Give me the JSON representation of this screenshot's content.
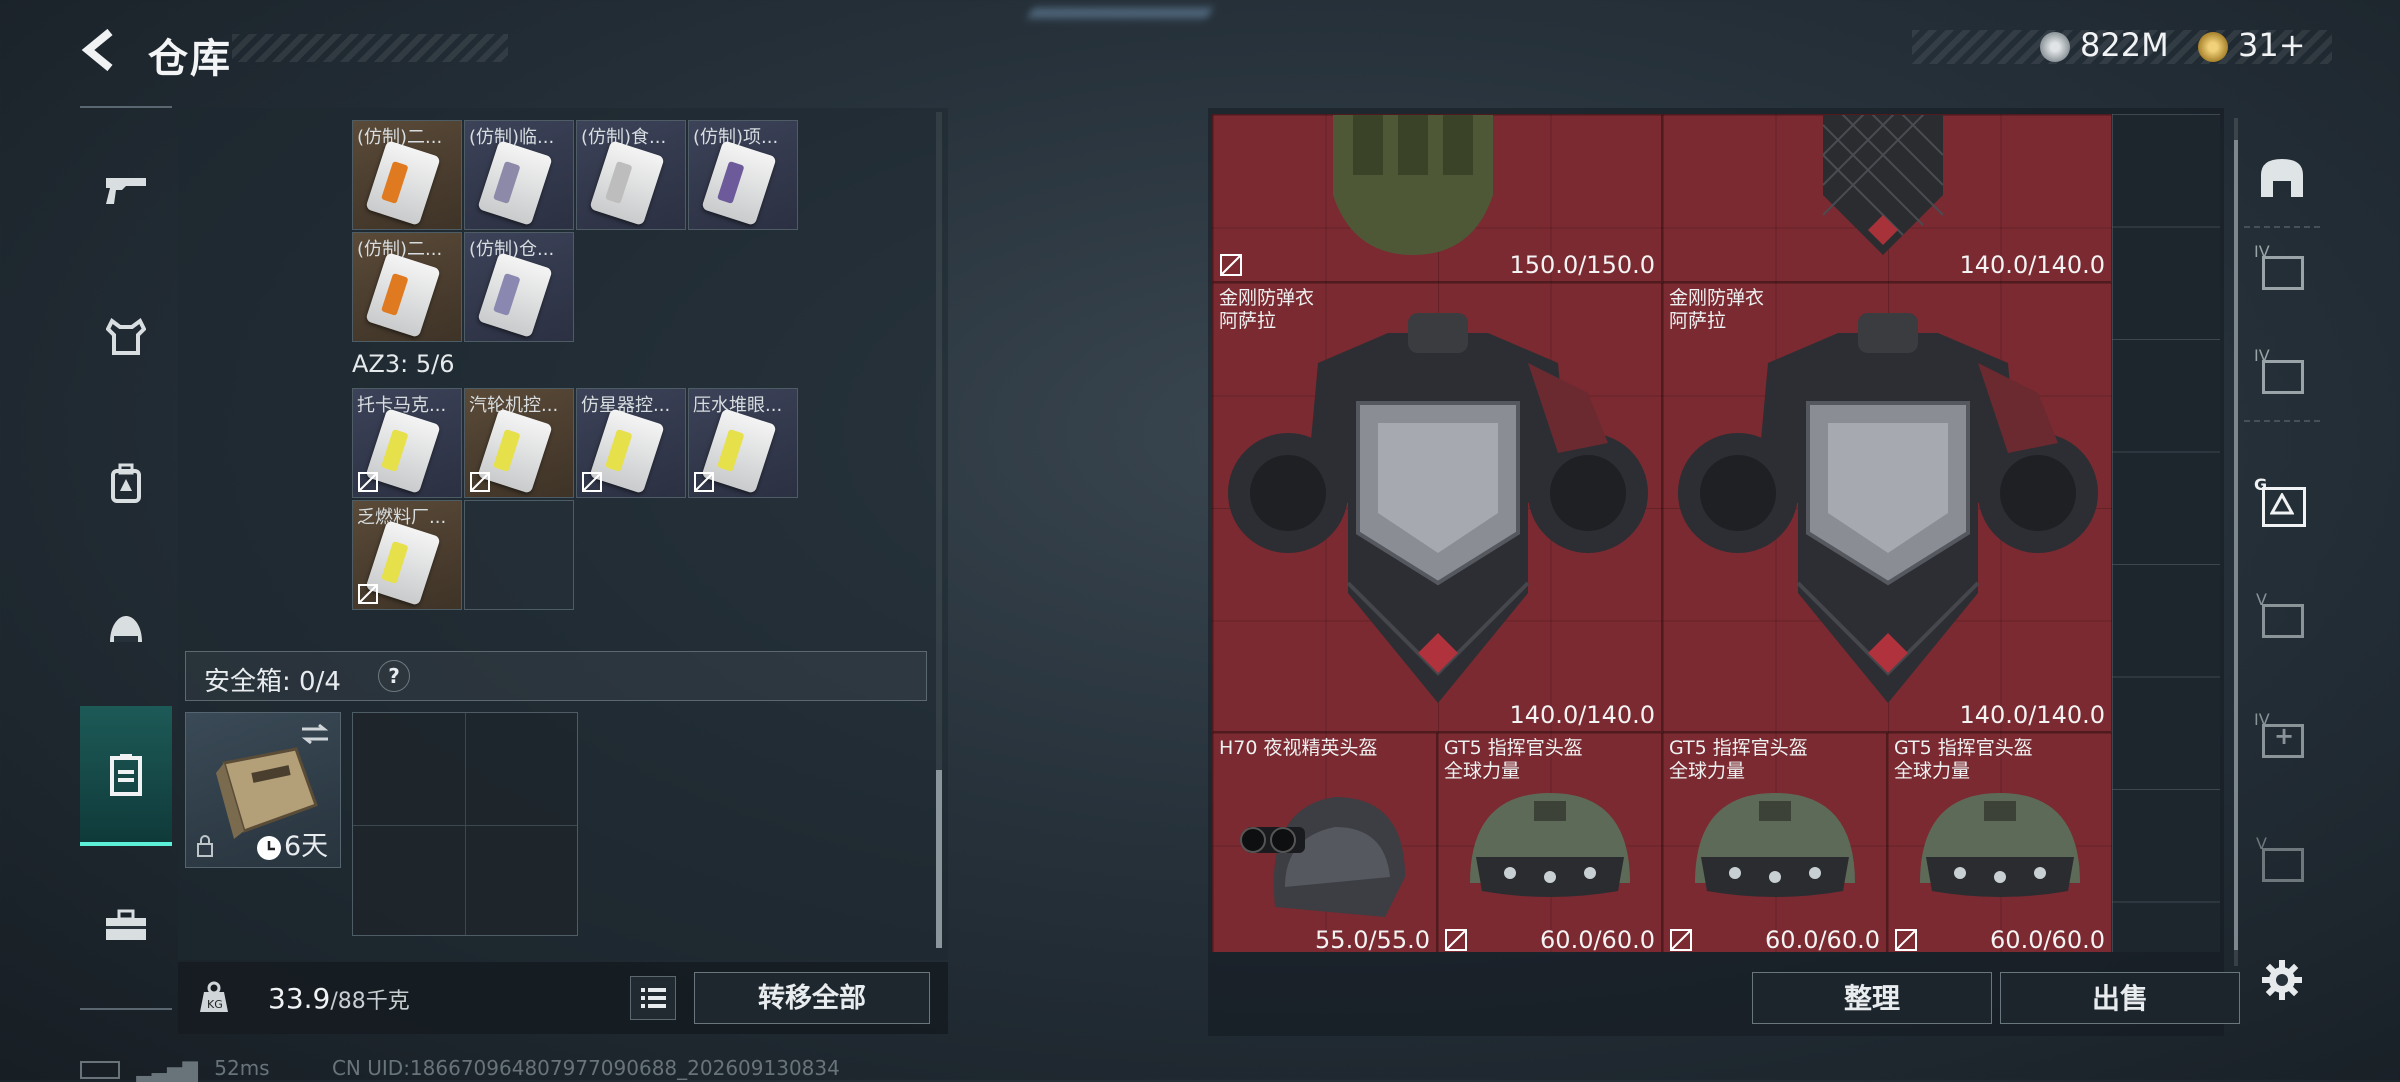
{
  "header": {
    "title": "仓库",
    "currency": [
      {
        "icon": "silver-coin-icon",
        "value": "822M"
      },
      {
        "icon": "gold-coin-icon",
        "value": "31+"
      }
    ]
  },
  "leftnav": [
    "gun-icon",
    "vest-icon",
    "backpack-icon",
    "helmet-icon",
    "safebox-icon",
    "toolbox-icon"
  ],
  "backpack": {
    "row1": [
      {
        "label": "(仿制)二...",
        "color": "brown",
        "band": "#e07a20"
      },
      {
        "label": "(仿制)临...",
        "color": "navy",
        "band": "#8c8aa8"
      },
      {
        "label": "(仿制)食...",
        "color": "navy",
        "band": "#c8c8c8"
      },
      {
        "label": "(仿制)项...",
        "color": "navy",
        "band": "#6c5a9a"
      }
    ],
    "row2": [
      {
        "label": "(仿制)二...",
        "color": "brown",
        "band": "#e07a20"
      },
      {
        "label": "(仿制)仓...",
        "color": "navy",
        "band": "#8a88b0"
      }
    ],
    "az3_label": "AZ3: 5/6",
    "row3": [
      {
        "label": "托卡马克...",
        "color": "navy",
        "band": "#e6e04a"
      },
      {
        "label": "汽轮机控...",
        "color": "brown",
        "band": "#e6e04a"
      },
      {
        "label": "仿星器控...",
        "color": "navy",
        "band": "#e6e04a"
      },
      {
        "label": "压水堆眼...",
        "color": "navy",
        "band": "#e6e04a"
      }
    ],
    "row4": [
      {
        "label": "乏燃料厂...",
        "color": "brown",
        "band": "#e6e04a"
      }
    ]
  },
  "safebox": {
    "label": "安全箱: 0/4",
    "help": "?",
    "item_timer": "6天"
  },
  "weight": {
    "current": "33.9",
    "max": "/88千克",
    "transfer_all": "转移全部"
  },
  "status": {
    "ping": "52ms",
    "uid": "CN UID:1866709648079770906​88_202609130834"
  },
  "stash": {
    "items": [
      {
        "name": "",
        "durability": "150.0/150.0",
        "type": "vest-olive"
      },
      {
        "name": "",
        "durability": "140.0/140.0",
        "type": "vest-red-top"
      },
      {
        "name": "金刚防弹衣\n阿萨拉",
        "durability": "140.0/140.0",
        "type": "vest"
      },
      {
        "name": "金刚防弹衣\n阿萨拉",
        "durability": "140.0/140.0",
        "type": "vest"
      },
      {
        "name": "H70 夜视精英头盔",
        "durability": "55.0/55.0",
        "type": "nv-helmet"
      },
      {
        "name": "GT5 指挥官头盔\n全球力量",
        "durability": "60.0/60.0",
        "type": "helmet"
      },
      {
        "name": "GT5 指挥官头盔\n全球力量",
        "durability": "60.0/60.0",
        "type": "helmet"
      },
      {
        "name": "GT5 指挥官头盔\n全球力量",
        "durability": "60.0/60.0",
        "type": "helmet"
      }
    ],
    "sort_label": "整理",
    "sell_label": "出售"
  },
  "right_tabs": [
    "armor-tab-icon",
    "IV-case-icon",
    "IV-case-icon",
    "G-case-icon",
    "V-case-icon",
    "IV-plus-icon",
    "V-case-icon",
    "settings-icon"
  ],
  "right_tab_labels": [
    "IV",
    "IV",
    "G",
    "V",
    "IV",
    "V"
  ],
  "colors": {
    "accent": "#5cf0d8",
    "item_red": "#7a2a30"
  }
}
